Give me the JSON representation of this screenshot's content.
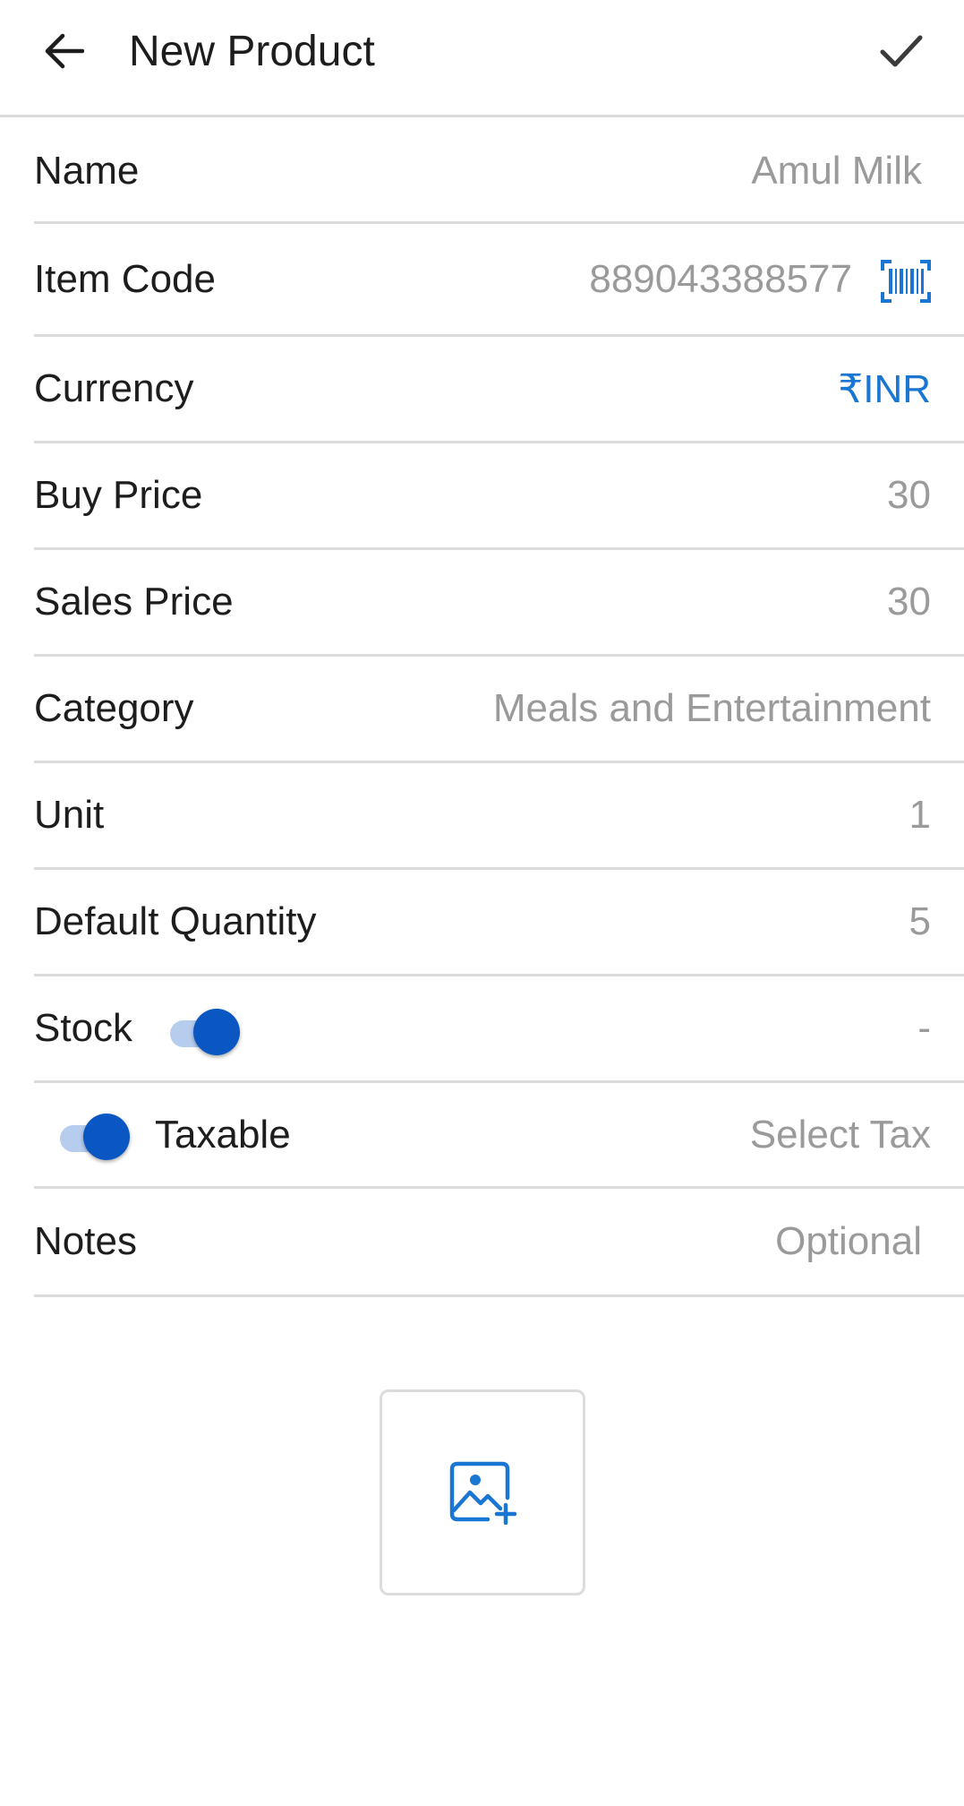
{
  "header": {
    "title": "New Product",
    "back_icon": "arrow-back-icon",
    "save_icon": "check-icon"
  },
  "form": {
    "name": {
      "label": "Name",
      "value": "Amul Milk"
    },
    "item_code": {
      "label": "Item Code",
      "value": "889043388577",
      "icon": "barcode-scan-icon"
    },
    "currency": {
      "label": "Currency",
      "value": "₹INR"
    },
    "buy_price": {
      "label": "Buy Price",
      "value": "30"
    },
    "sales_price": {
      "label": "Sales Price",
      "value": "30"
    },
    "category": {
      "label": "Category",
      "value": "Meals and Entertainment"
    },
    "unit": {
      "label": "Unit",
      "value": "1"
    },
    "default_quantity": {
      "label": "Default Quantity",
      "value": "5"
    },
    "stock": {
      "label": "Stock",
      "enabled": true,
      "value": "-"
    },
    "taxable": {
      "label": "Taxable",
      "enabled": true,
      "value": "Select Tax"
    },
    "notes": {
      "label": "Notes",
      "placeholder": "Optional"
    }
  },
  "image_picker": {
    "icon": "add-photo-icon"
  },
  "colors": {
    "accent": "#1976d2",
    "switch_thumb": "#0a56c2",
    "switch_track": "#b6cdee",
    "muted_text": "#9a9a9a",
    "divider": "#dcdcdc"
  }
}
